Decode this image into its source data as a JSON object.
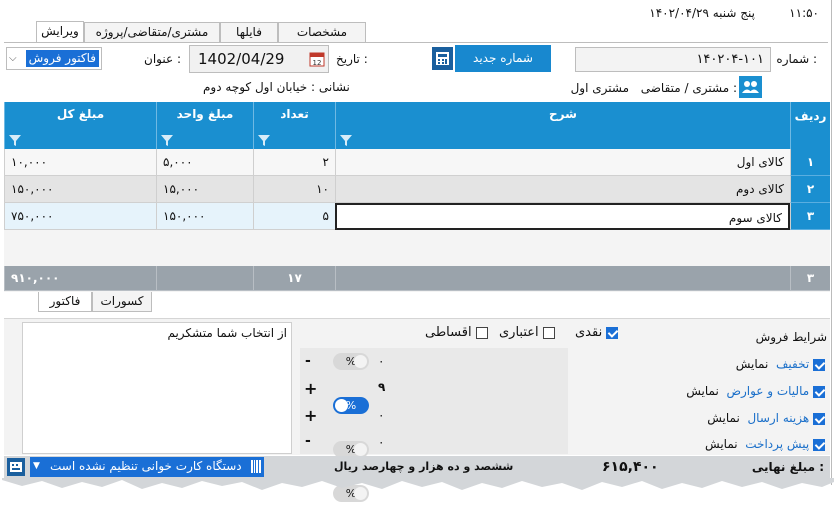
{
  "header": {
    "time": "۱۱:۵۰",
    "weekday_date": "پنج شنبه  ۱۴۰۲/۰۴/۲۹",
    "tabs": [
      {
        "label": "ویرایش"
      },
      {
        "label": "مشتری/متقاضی/پروژه"
      },
      {
        "label": "فایلها"
      },
      {
        "label": "مشخصات"
      }
    ]
  },
  "form": {
    "number_label": "شماره :",
    "number_value": "۱۴۰۲۰۴-۱۰۱",
    "new_number_button": "شماره جدید",
    "date_label": "تاریخ :",
    "date_value": "1402/04/29",
    "title_label": "عنوان :",
    "title_value": "فاکتور فروش",
    "customer_label": "مشتری / متقاضی :",
    "customer_value": "مشتری اول",
    "address_label": "نشانی :",
    "address_value": "خیابان اول کوچه دوم"
  },
  "grid": {
    "columns": [
      "ردیف",
      "شرح",
      "تعداد",
      "مبلغ واحد",
      "مبلغ کل"
    ],
    "rows": [
      {
        "no": "۱",
        "desc": "کالای اول",
        "qty": "۲",
        "unit": "۵,۰۰۰",
        "total": "۱۰,۰۰۰"
      },
      {
        "no": "۲",
        "desc": "کالای دوم",
        "qty": "۱۰",
        "unit": "۱۵,۰۰۰",
        "total": "۱۵۰,۰۰۰"
      },
      {
        "no": "۳",
        "desc": "کالای سوم",
        "qty": "۵",
        "unit": "۱۵۰,۰۰۰",
        "total": "۷۵۰,۰۰۰"
      }
    ],
    "summary": {
      "count": "۳",
      "qty": "۱۷",
      "total": "۹۱۰,۰۰۰"
    }
  },
  "bottom_tabs": [
    {
      "label": "فاکتور"
    },
    {
      "label": "کسورات"
    }
  ],
  "conditions": {
    "title": "شرایط فروش",
    "show_label": "نمایش",
    "items": [
      {
        "label": "تخفیف",
        "checked": true,
        "toggle_on": false,
        "value": "۰",
        "sign": "-"
      },
      {
        "label": "مالیات و عوارض",
        "checked": true,
        "toggle_on": true,
        "value": "۹",
        "sign": "+"
      },
      {
        "label": "هزینه ارسال",
        "checked": true,
        "toggle_on": false,
        "value": "۰",
        "sign": "+"
      },
      {
        "label": "پیش پرداخت",
        "checked": true,
        "toggle_on": false,
        "value": "۰",
        "sign": "-"
      }
    ],
    "percent_symbol": "%",
    "payment_types": [
      {
        "label": "نقدی",
        "checked": true
      },
      {
        "label": "اعتباری",
        "checked": false
      },
      {
        "label": "اقساطی",
        "checked": false
      }
    ]
  },
  "note": "از انتخاب شما متشکریم",
  "footer": {
    "final_label": "مبلغ نهایی :",
    "final_value": "۶۱۵,۴۰۰",
    "final_words": "ششصد و ده هزار و چهارصد ریال",
    "device_status": "دستگاه کارت خوانی تنظیم نشده است"
  },
  "colors": {
    "accent": "#1a8fd0",
    "button": "#1888cf",
    "link": "#1a6fc9",
    "summary": "#9aa3ab"
  }
}
